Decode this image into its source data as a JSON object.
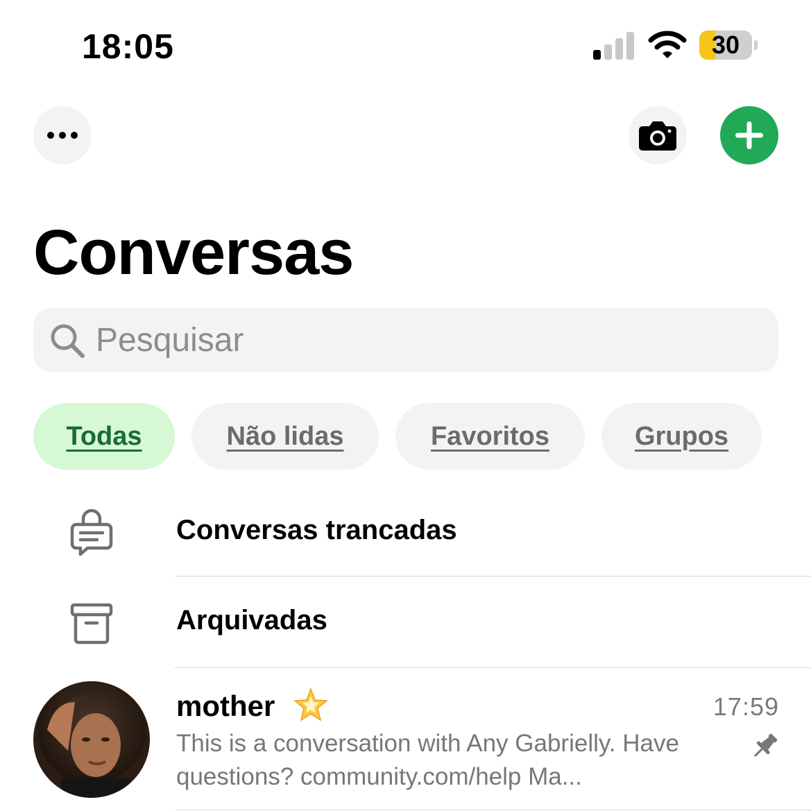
{
  "status_bar": {
    "time": "18:05",
    "battery_level": "30",
    "battery_fraction": 0.3,
    "signal_bars_active": 1,
    "signal_bars_total": 4,
    "icons": [
      "signal-icon",
      "wifi-icon",
      "battery-icon"
    ]
  },
  "header": {
    "menu_icon": "ellipsis-icon",
    "camera_icon": "camera-icon",
    "new_chat_icon": "plus-icon",
    "accent_color": "#21a957"
  },
  "page": {
    "title": "Conversas"
  },
  "search": {
    "placeholder": "Pesquisar",
    "value": "",
    "icon": "search-icon"
  },
  "filters": [
    {
      "label": "Todas",
      "active": true
    },
    {
      "label": "Não lidas",
      "active": false
    },
    {
      "label": "Favoritos",
      "active": false
    },
    {
      "label": "Grupos",
      "active": false
    }
  ],
  "special_rows": [
    {
      "label": "Conversas trancadas",
      "icon": "locked-chat-icon"
    },
    {
      "label": "Arquivadas",
      "icon": "archive-icon"
    }
  ],
  "chats": [
    {
      "name": "mother",
      "emoji": "star-emoji",
      "time": "17:59",
      "preview": "This is a conversation with Any Gabrielly. Have questions? community.com/help Ma...",
      "pinned": true,
      "pin_icon": "pin-icon"
    }
  ],
  "colors": {
    "accent": "#21a957",
    "chip_active_bg": "#d6f8d4",
    "chip_active_text": "#1a6b35",
    "battery_yellow": "#f5c518"
  }
}
